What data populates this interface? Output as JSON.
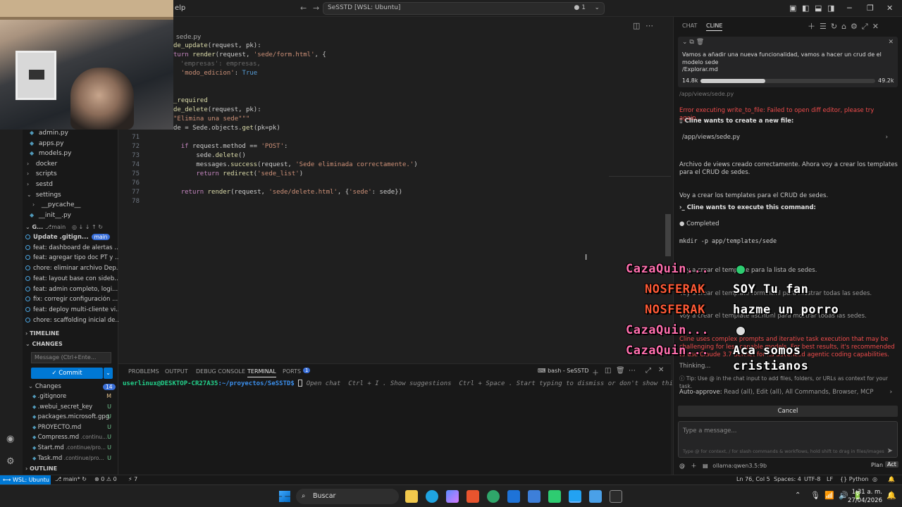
{
  "titlebar": {
    "menu_help": "elp",
    "command_center": "SeSSTD [WSL: Ubuntu]",
    "problems_count": "1"
  },
  "editor": {
    "breadcrumb": "sede.py",
    "lines": [
      {
        "n": "",
        "html": "<span class='fn'>de_update</span>(request, pk):"
      },
      {
        "n": "",
        "html": "<span class='kw'>turn</span> <span class='fn'>render</span>(request, <span class='str'>'sede/form.html'</span>, {"
      },
      {
        "n": "",
        "html": "  <span class='str'>'modo_edicion'</span>: <span class='kc'>True</span>"
      },
      {
        "n": "",
        "html": ""
      },
      {
        "n": "",
        "html": ""
      },
      {
        "n": "",
        "html": "<span class='dec'>_required</span>"
      },
      {
        "n": "",
        "html": "<span class='fn'>de_delete</span>(request, pk):"
      },
      {
        "n": "",
        "html": "<span class='str'>\"Elimina una sede\"\"\"</span>"
      },
      {
        "n": "",
        "html": "de = Sede.objects.<span class='fn'>get</span>(pk=pk)"
      },
      {
        "n": "71",
        "html": ""
      },
      {
        "n": "72",
        "html": "    <span class='kw'>if</span> request.method == <span class='str'>'POST'</span>:"
      },
      {
        "n": "73",
        "html": "        sede.<span class='fn'>delete</span>()"
      },
      {
        "n": "74",
        "html": "        messages.<span class='fn'>success</span>(request, <span class='str'>'Sede eliminada correctamente.'</span>)"
      },
      {
        "n": "75",
        "html": "        <span class='kw'>return</span> <span class='fn'>redirect</span>(<span class='str'>'sede_list'</span>)"
      },
      {
        "n": "76",
        "html": ""
      },
      {
        "n": "77",
        "html": "    <span class='kw'>return</span> <span class='fn'>render</span>(request, <span class='str'>'sede/delete.html'</span>, {<span class='str'>'sede'</span>: sede})"
      },
      {
        "n": "78",
        "html": ""
      }
    ]
  },
  "sidebar": {
    "files": [
      "admin.py",
      "apps.py",
      "models.py",
      "docker",
      "scripts",
      "sestd",
      "settings",
      "__pycache__",
      "__init__.py"
    ],
    "git_header": "G...",
    "git_branch": "main",
    "commits": [
      "Update .gitign...",
      "feat: dashboard de alertas ...",
      "feat: agregar tipo doc PT y ...",
      "chore: eliminar archivo Dep...",
      "feat: layout base con sideb...",
      "feat: admin completo, logi...",
      "fix: corregir configuración ...",
      "feat: deploy multi-cliente vi...",
      "chore: scaffolding inicial de..."
    ],
    "commit_badge": "main",
    "timeline": "TIMELINE",
    "changes_section": "CHANGES",
    "message_placeholder": "Message (Ctrl+Ente...",
    "commit_label": "✓ Commit",
    "changes_label": "Changes",
    "changes_count": "14",
    "changes": [
      {
        "name": ".gitignore",
        "dim": "",
        "status": "M"
      },
      {
        "name": ".webui_secret_key",
        "dim": "",
        "status": "U"
      },
      {
        "name": "packages.microsoft.gpg",
        "dim": "",
        "status": "U"
      },
      {
        "name": "PROYECTO.md",
        "dim": "",
        "status": "U"
      },
      {
        "name": "Compress.md",
        "dim": ".continu...",
        "status": "U"
      },
      {
        "name": "Start.md",
        "dim": ".continue/pro...",
        "status": "U"
      },
      {
        "name": "Task.md",
        "dim": ".continue/pro...",
        "status": "U"
      }
    ],
    "outline": "OUTLINE"
  },
  "panel": {
    "tabs": [
      "PROBLEMS",
      "OUTPUT",
      "DEBUG CONSOLE",
      "TERMINAL",
      "PORTS"
    ],
    "ports_badge": "1",
    "shell": "bash - SeSSTD",
    "prompt_user": "userlinux@DESKTOP-CR27A35",
    "prompt_path": ":~/proyectos/SeSSTD$",
    "hint": "Open chat  Ctrl + I . Show suggestions  Ctrl + Space . Start typing to dismiss or don't show this again."
  },
  "chat": {
    "tabs": [
      "CHAT",
      "CLINE"
    ],
    "task_text": "Vamos a añadir una nueva funcionalidad, vamos a hacer un crud de el modelo sede",
    "task_file": "/Explorar.md",
    "tokens_in": "14.8k",
    "tokens_out": "49.2k",
    "progress": 0.37,
    "hidden_path": "/app/views/sede.py",
    "error": "Error executing write_to_file: Failed to open diff editor, please try again...",
    "create_file": "Cline wants to create a new file:",
    "new_file_path": "/app/views/sede.py",
    "msg1": "Archivo de views creado correctamente. Ahora voy a crear los templates para el CRUD de sedes.",
    "msg2": "Voy a crear los templates para el CRUD de sedes.",
    "exec_cmd": "Cline wants to execute this command:",
    "completed": "Completed",
    "command": "mkdir -p app/templates/sede",
    "msg3": "Voy a crear el template para la lista de sedes.",
    "msg4": "Voy a crear el template form.html para mostrar todas las sedes.",
    "msg5": "Voy a crear el template list.html para mostrar todas las sedes.",
    "warning": "Cline uses complex prompts and iterative task execution that may be challenging for less capable models. For best results, it's recommended to use Claude 3.7 Sonnet for its advanced agentic coding capabilities.",
    "thinking": "Thinking...",
    "tip": "Tip: Use @ in the chat input to add files, folders, or URLs as context for your task.",
    "auto_approve_label": "Auto-approve:",
    "auto_approve_value": "Read (all), Edit (all), All Commands, Browser, MCP",
    "cancel": "Cancel",
    "input_placeholder": "Type a message...",
    "input_hint": "Type @ for context, / for slash commands & workflows, hold shift to drag in files/images",
    "model": "ollama:qwen3.5:9b",
    "mode_plan": "Plan",
    "mode_act": "Act"
  },
  "overlay": [
    {
      "user": "CazaQuin...",
      "msg": "",
      "color": "pink"
    },
    {
      "user": "NOSFERAK",
      "msg": "SOY Tu fan",
      "color": "red"
    },
    {
      "user": "NOSFERAK",
      "msg": "hazme un porro",
      "color": "red"
    },
    {
      "user": "CazaQuin...",
      "msg": "",
      "color": "pink"
    },
    {
      "user": "CazaQuin...",
      "msg": "Aca somos",
      "color": "pink"
    },
    {
      "user": "",
      "msg": "cristianos",
      "color": "white"
    }
  ],
  "statusbar": {
    "remote": "WSL: Ubuntu",
    "branch": "main*",
    "errors": "0",
    "warnings": "0",
    "ports": "7",
    "position": "Ln 76, Col 5",
    "spaces": "Spaces: 4",
    "encoding": "UTF-8",
    "eol": "LF",
    "language": "Python"
  },
  "taskbar": {
    "search": "Buscar",
    "time": "1:31 a. m.",
    "date": "27/04/2026"
  },
  "colors": {
    "accent": "#0078d4",
    "error": "#f14c4c",
    "git_added": "#73c991",
    "git_modified": "#e2c08d"
  }
}
